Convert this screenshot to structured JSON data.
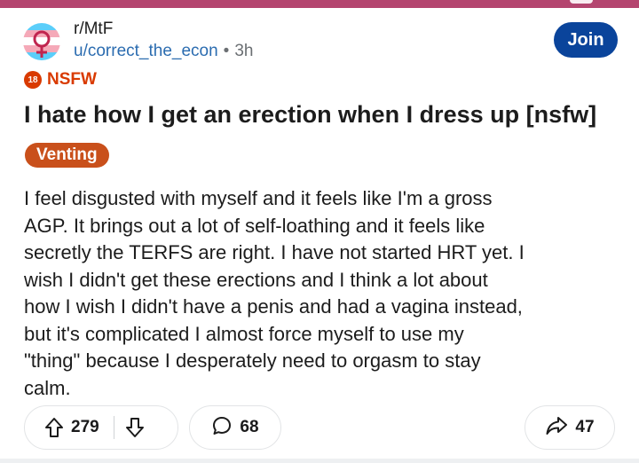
{
  "subreddit": "r/MtF",
  "author": "u/correct_the_econ",
  "separator": "•",
  "time_ago": "3h",
  "join_label": "Join",
  "nsfw": {
    "badge": "18",
    "label": "NSFW"
  },
  "title": "I hate how I get an erection when I dress up [nsfw]",
  "flair": "Venting",
  "body_lines": [
    "I feel disgusted with myself and it feels like I'm a gross",
    "AGP. It brings out a lot of self-loathing and it feels like",
    "secretly the TERFS are right. I have not started HRT yet. I",
    "wish I didn't get these erections and I think a lot about",
    "how I wish I didn't have a penis and had a vagina instead,",
    "but it's complicated I almost force myself to use my",
    "\"thing\" because I desperately need to orgasm to stay",
    "calm."
  ],
  "actions": {
    "upvotes": "279",
    "comments": "68",
    "shares": "47"
  },
  "icons": {
    "avatar": "transgender-flag-avatar",
    "upvote": "upvote-arrow-icon",
    "downvote": "downvote-arrow-icon",
    "comment": "comment-bubble-icon",
    "share": "share-arrow-icon"
  },
  "colors": {
    "top_bar": "#b4456f",
    "join_button": "#0a449b",
    "username": "#2b6cb0",
    "nsfw": "#d93a00",
    "flair_bg": "#c9501b"
  }
}
